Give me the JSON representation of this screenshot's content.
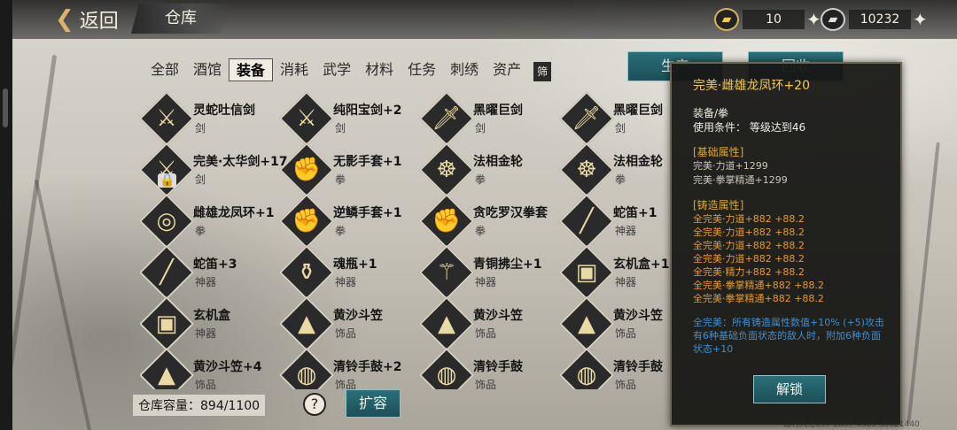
{
  "topbar": {
    "back_label": "返回",
    "title": "仓库"
  },
  "currency": {
    "gold": {
      "icon": "gold-ingot-icon",
      "value": "10"
    },
    "silver": {
      "icon": "silver-ingot-icon",
      "value": "10232"
    }
  },
  "tabs": [
    "全部",
    "酒馆",
    "装备",
    "消耗",
    "武学",
    "材料",
    "任务",
    "刺绣",
    "资产"
  ],
  "active_tab": 2,
  "filter_label": "筛",
  "actions": {
    "produce_label": "生产",
    "recycle_label": "回收"
  },
  "items": [
    {
      "name": "灵蛇吐信剑",
      "type": "剑",
      "icon": "sword-icon"
    },
    {
      "name": "纯阳宝剑+2",
      "type": "剑",
      "icon": "sword-icon"
    },
    {
      "name": "黑曜巨剑",
      "type": "剑",
      "icon": "greatsword-icon"
    },
    {
      "name": "黑曜巨剑",
      "type": "剑",
      "icon": "greatsword-icon"
    },
    {
      "name": "完美·太华剑+17",
      "type": "剑",
      "icon": "sword-icon",
      "locked": true
    },
    {
      "name": "无影手套+1",
      "type": "拳",
      "icon": "gauntlet-icon"
    },
    {
      "name": "法相金轮",
      "type": "拳",
      "icon": "golden-wheel-icon"
    },
    {
      "name": "法相金轮",
      "type": "拳",
      "icon": "golden-wheel-icon"
    },
    {
      "name": "雌雄龙凤环+1",
      "type": "拳",
      "icon": "dragon-ring-icon"
    },
    {
      "name": "逆鳞手套+1",
      "type": "拳",
      "icon": "gauntlet-icon"
    },
    {
      "name": "贪吃罗汉拳套",
      "type": "拳",
      "icon": "gauntlet-icon"
    },
    {
      "name": "蛇笛+1",
      "type": "神器",
      "icon": "flute-icon"
    },
    {
      "name": "蛇笛+3",
      "type": "神器",
      "icon": "flute-icon"
    },
    {
      "name": "魂瓶+1",
      "type": "神器",
      "icon": "soul-bottle-icon"
    },
    {
      "name": "青铜拂尘+1",
      "type": "神器",
      "icon": "whisk-icon"
    },
    {
      "name": "玄机盒+1",
      "type": "神器",
      "icon": "puzzle-box-icon"
    },
    {
      "name": "玄机盒",
      "type": "神器",
      "icon": "puzzle-box-icon"
    },
    {
      "name": "黄沙斗笠",
      "type": "饰品",
      "icon": "straw-hat-icon"
    },
    {
      "name": "黄沙斗笠",
      "type": "饰品",
      "icon": "straw-hat-icon"
    },
    {
      "name": "黄沙斗笠",
      "type": "饰品",
      "icon": "straw-hat-icon"
    },
    {
      "name": "黄沙斗笠+4",
      "type": "饰品",
      "icon": "straw-hat-icon"
    },
    {
      "name": "清铃手鼓+2",
      "type": "饰品",
      "icon": "hand-drum-icon"
    },
    {
      "name": "清铃手鼓",
      "type": "饰品",
      "icon": "hand-drum-icon"
    },
    {
      "name": "清铃手鼓",
      "type": "饰品",
      "icon": "hand-drum-icon"
    }
  ],
  "capacity": {
    "label": "仓库容量：",
    "value": "894/1100"
  },
  "help_label": "?",
  "expand_label": "扩容",
  "detail": {
    "title": "完美·雌雄龙凤环+20",
    "category": "装备/拳",
    "requirement": "使用条件：  等级达到46",
    "base_header": "[基础属性]",
    "base_attrs": [
      "完美·力道+1299",
      "完美·拳掌精通+1299"
    ],
    "forge_header": "[铸造属性]",
    "forge_attrs": [
      "全完美·力道+882  +88.2",
      "全完美·力道+882  +88.2",
      "全完美·力道+882  +88.2",
      "全完美·力道+882  +88.2",
      "全完美·精力+882  +88.2",
      "全完美·拳掌精通+882  +88.2",
      "全完美·拳掌精通+882  +88.2"
    ],
    "bonus": "全完美：所有铸造属性数值+10% (+5)攻击有6种基础负面状态的敌人时，附加6种负面状态+10",
    "unlock_label": "解锁"
  },
  "watermark": "山村大宅157-2857 4385 36021440"
}
